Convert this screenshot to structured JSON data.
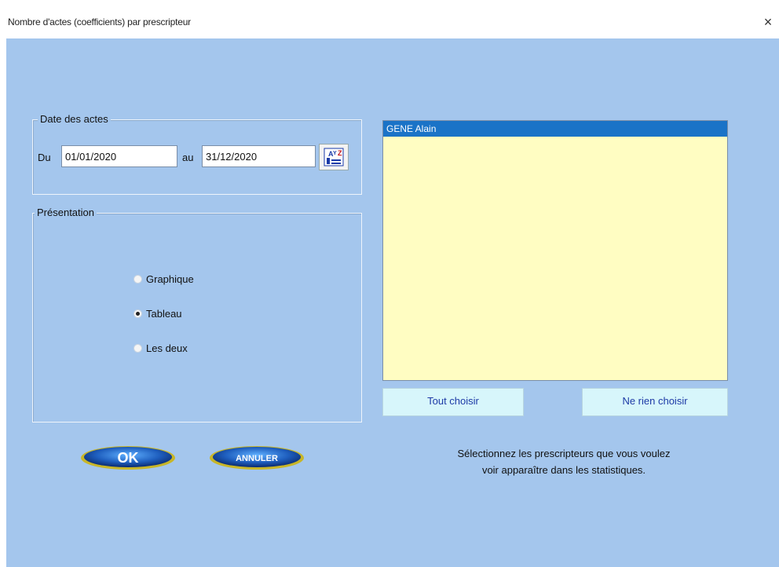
{
  "window": {
    "title": "Nombre d'actes (coefficients) par prescripteur",
    "close_label": "×"
  },
  "dates": {
    "legend": "Date des actes",
    "from_label": "Du",
    "from_value": "01/01/2020",
    "to_label": "au",
    "to_value": "31/12/2020",
    "calendar_icon": "calendar-icon"
  },
  "presentation": {
    "legend": "Présentation",
    "options": [
      {
        "label": "Graphique",
        "checked": false
      },
      {
        "label": "Tableau",
        "checked": true
      },
      {
        "label": "Les deux",
        "checked": false
      }
    ]
  },
  "buttons": {
    "ok_label": "OK",
    "cancel_label": "ANNULER"
  },
  "prescribers": {
    "items": [
      {
        "label": "GENE Alain",
        "selected": true
      }
    ],
    "select_all_label": "Tout choisir",
    "select_none_label": "Ne rien choisir",
    "hint_line1": "Sélectionnez les prescripteurs que vous voulez",
    "hint_line2": "voir apparaître dans les statistiques."
  },
  "colors": {
    "background": "#a4c6ed",
    "list_background": "#fffdc2",
    "selection": "#1a73c7",
    "button_pale": "#d7f6fb"
  }
}
